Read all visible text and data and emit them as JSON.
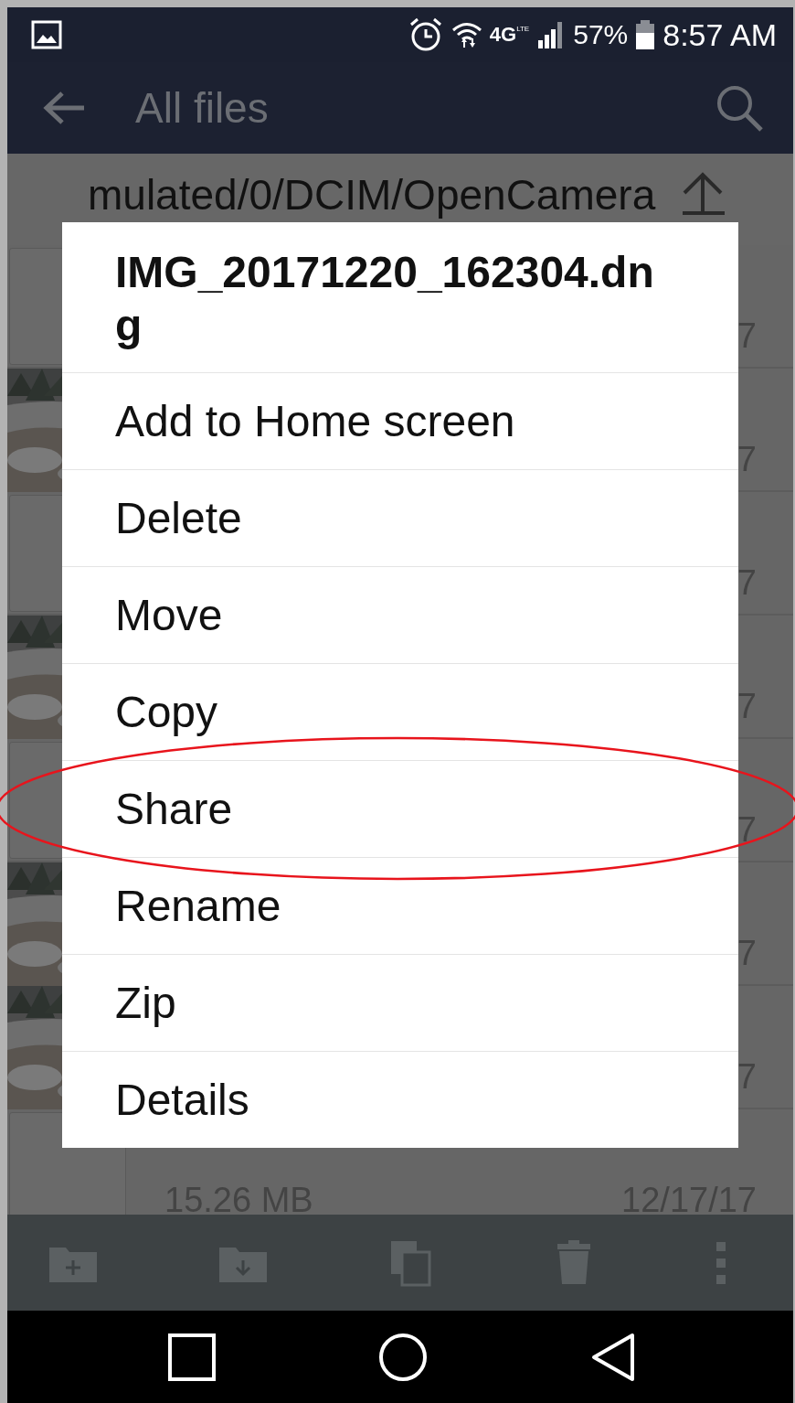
{
  "status_bar": {
    "battery": "57%",
    "time": "8:57 AM",
    "network": "4G",
    "network_sub": "LTE"
  },
  "app_bar": {
    "title": "All files"
  },
  "path": "mulated/0/DCIM/OpenCamera",
  "file_rows": [
    {
      "kind": "placeholder",
      "date": "7"
    },
    {
      "kind": "picture",
      "date": "7"
    },
    {
      "kind": "placeholder",
      "date": "7"
    },
    {
      "kind": "picture",
      "date": "7"
    },
    {
      "kind": "placeholder",
      "date": "7"
    },
    {
      "kind": "picture",
      "date": "7"
    },
    {
      "kind": "picture",
      "date": "7"
    },
    {
      "kind": "placeholder",
      "size": "15.26 MB",
      "date": "12/17/17"
    }
  ],
  "dialog": {
    "title": "IMG_20171220_162304.dng",
    "items": [
      {
        "label": "Add to Home screen",
        "circled": false
      },
      {
        "label": "Delete",
        "circled": false
      },
      {
        "label": "Move",
        "circled": false
      },
      {
        "label": "Copy",
        "circled": false
      },
      {
        "label": "Share",
        "circled": true
      },
      {
        "label": "Rename",
        "circled": false
      },
      {
        "label": "Zip",
        "circled": false
      },
      {
        "label": "Details",
        "circled": false
      }
    ]
  }
}
